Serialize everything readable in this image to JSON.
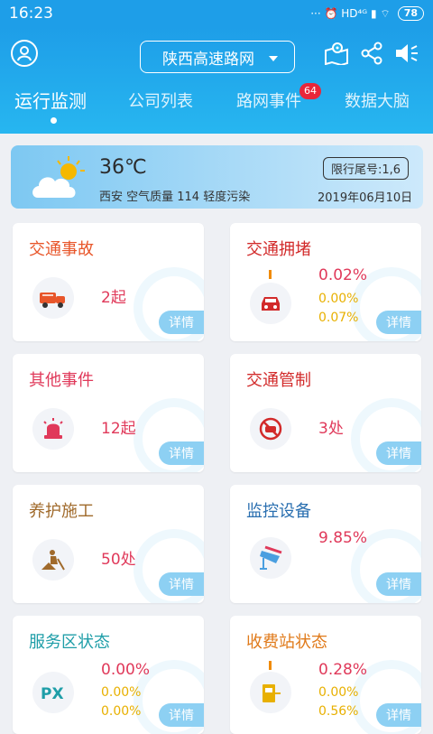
{
  "status_bar": {
    "time": "16:23",
    "indicators": "··· ⏰ HD⁴ᴳ ▮ ⌔",
    "battery": "78"
  },
  "header": {
    "region": "陕西高速路网",
    "tabs": [
      {
        "label": "运行监测"
      },
      {
        "label": "公司列表"
      },
      {
        "label": "路网事件",
        "badge": "64"
      },
      {
        "label": "数据大脑"
      }
    ]
  },
  "weather": {
    "temperature": "36℃",
    "air_quality": "西安 空气质量 114 轻度污染",
    "plate_limit": "限行尾号:1,6",
    "date": "2019年06月10日"
  },
  "details_label": "详情",
  "cards": [
    {
      "title": "交通事故",
      "title_color": "#e8562a",
      "value": "2起"
    },
    {
      "title": "交通拥堵",
      "title_color": "#d22a2a",
      "values": [
        "0.02%",
        "0.00%",
        "0.07%"
      ]
    },
    {
      "title": "其他事件",
      "title_color": "#e0395a",
      "value": "12起"
    },
    {
      "title": "交通管制",
      "title_color": "#d22a2a",
      "value": "3处"
    },
    {
      "title": "养护施工",
      "title_color": "#a06a2b",
      "value": "50处"
    },
    {
      "title": "监控设备",
      "title_color": "#2a6fb0",
      "value": "9.85%"
    },
    {
      "title": "服务区状态",
      "title_color": "#1f9ea8",
      "values": [
        "0.00%",
        "0.00%",
        "0.00%"
      ]
    },
    {
      "title": "收费站状态",
      "title_color": "#e07a1a",
      "values": [
        "0.28%",
        "0.00%",
        "0.56%"
      ]
    }
  ]
}
